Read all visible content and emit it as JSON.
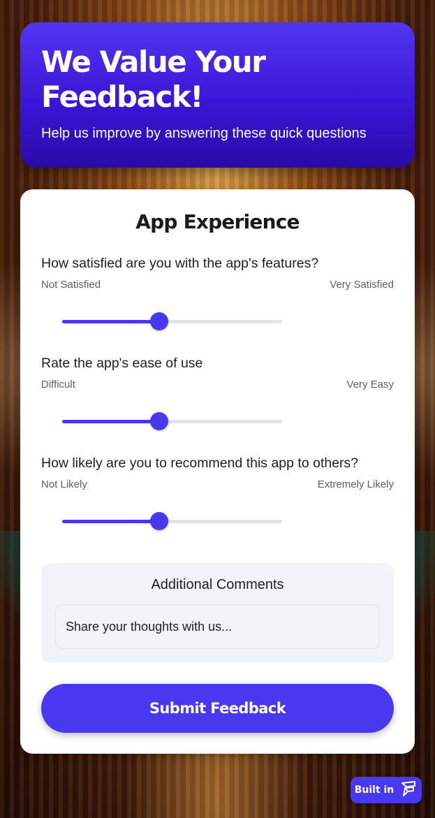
{
  "header": {
    "title": "We Value Your Feedback!",
    "subtitle": "Help us improve by answering these quick questions"
  },
  "section_title": "App Experience",
  "questions": [
    {
      "text": "How satisfied are you with the app's features?",
      "min_label": "Not Satisfied",
      "max_label": "Very Satisfied",
      "value_fraction": 0.44
    },
    {
      "text": "Rate the app's ease of use",
      "min_label": "Difficult",
      "max_label": "Very Easy",
      "value_fraction": 0.44
    },
    {
      "text": "How likely are you to recommend this app to others?",
      "min_label": "Not Likely",
      "max_label": "Extremely Likely",
      "value_fraction": 0.44
    }
  ],
  "comments": {
    "title": "Additional Comments",
    "placeholder": "Share your thoughts with us..."
  },
  "submit_label": "Submit Feedback",
  "badge": {
    "label": "Built in",
    "icon": "builder-logo-icon"
  },
  "colors": {
    "accent": "#4a38f0",
    "header_bg": "#3b16d8",
    "card_bg": "#ffffff"
  }
}
